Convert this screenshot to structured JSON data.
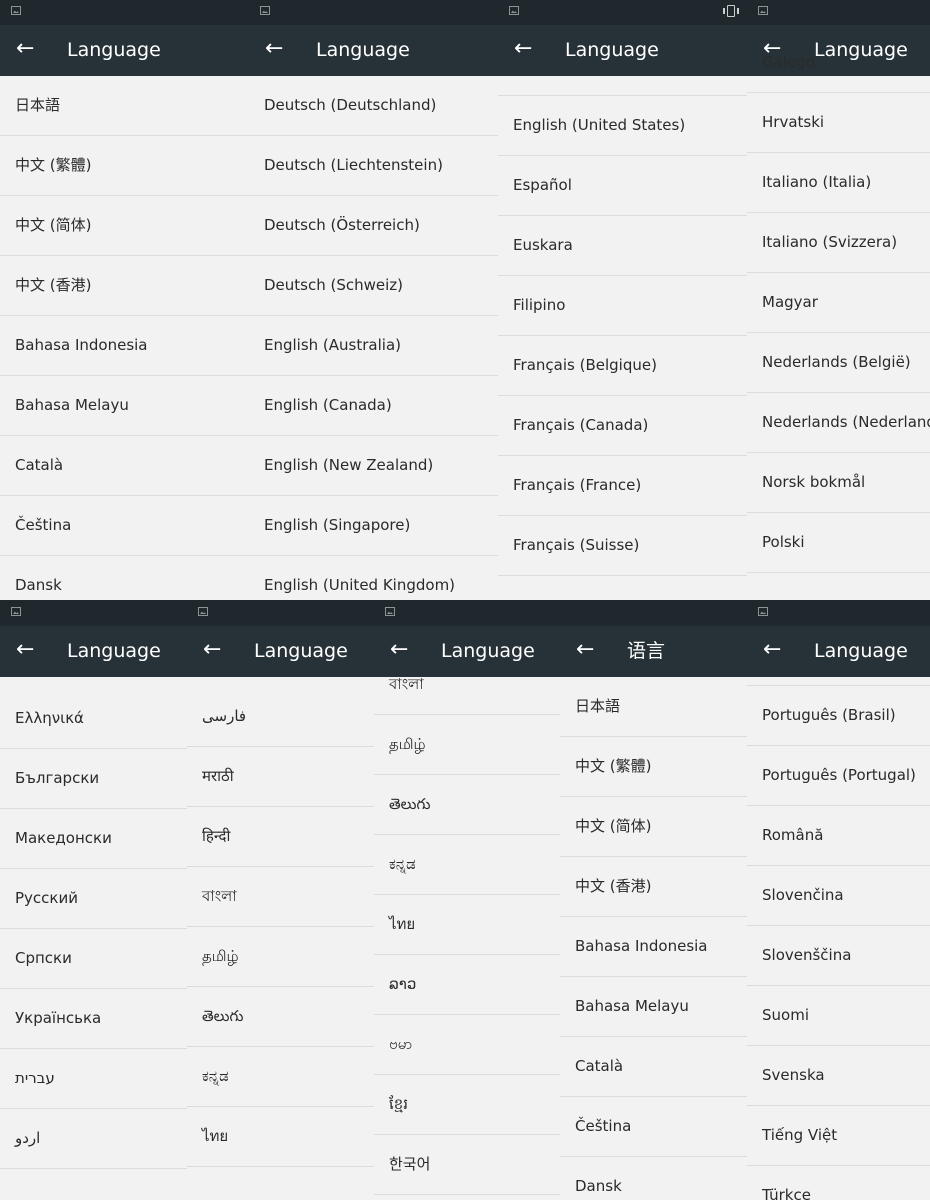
{
  "panels": [
    {
      "status_icons": [
        "image-icon"
      ],
      "title": "Language",
      "items": [
        "日本語",
        "中文 (繁體)",
        "中文 (简体)",
        "中文 (香港)",
        "Bahasa Indonesia",
        "Bahasa Melayu",
        "Català",
        "Čeština",
        "Dansk"
      ]
    },
    {
      "status_icons": [
        "image-icon"
      ],
      "title": "Language",
      "items": [
        "Deutsch (Deutschland)",
        "Deutsch (Liechtenstein)",
        "Deutsch (Österreich)",
        "Deutsch (Schweiz)",
        "English (Australia)",
        "English (Canada)",
        "English (New Zealand)",
        "English (Singapore)",
        "English (United Kingdom)"
      ]
    },
    {
      "status_icons": [
        "image-icon",
        "vibrate-icon"
      ],
      "title": "Language",
      "items": [
        "",
        "English (United States)",
        "Español",
        "Euskara",
        "Filipino",
        "Français (Belgique)",
        "Français (Canada)",
        "Français (France)",
        "Français (Suisse)"
      ]
    },
    {
      "status_icons": [
        "image-icon"
      ],
      "title": "Language",
      "items": [
        "Galego",
        "Hrvatski",
        "Italiano (Italia)",
        "Italiano (Svizzera)",
        "Magyar",
        "Nederlands (België)",
        "Nederlands (Nederland)",
        "Norsk bokmål",
        "Polski"
      ]
    },
    {
      "status_icons": [
        "image-icon"
      ],
      "title": "Language",
      "items": [
        "Ελληνικά",
        "Български",
        "Македонски",
        "Русский",
        "Српски",
        "Українська",
        "עברית",
        "اردو"
      ]
    },
    {
      "status_icons": [
        "image-icon"
      ],
      "title": "Language",
      "items": [
        "فارسی",
        "मराठी",
        "हिन्दी",
        "বাংলা",
        "தமிழ்",
        "తెలుగు",
        "ಕನ್ನಡ",
        "ไทย"
      ]
    },
    {
      "status_icons": [
        "image-icon"
      ],
      "title": "Language",
      "items": [
        "বাংলা",
        "தமிழ்",
        "తెలుగు",
        "ಕನ್ನಡ",
        "ไทย",
        "ລາວ",
        "ဗမာ",
        "ខ្មែរ",
        "한국어"
      ]
    },
    {
      "status_icons": [],
      "title": "语言",
      "items": [
        "日本語",
        "中文 (繁體)",
        "中文 (简体)",
        "中文 (香港)",
        "Bahasa Indonesia",
        "Bahasa Melayu",
        "Català",
        "Čeština",
        "Dansk"
      ]
    },
    {
      "status_icons": [
        "image-icon"
      ],
      "title": "Language",
      "items": [
        "",
        "Português (Brasil)",
        "Português (Portugal)",
        "Română",
        "Slovenčina",
        "Slovenščina",
        "Suomi",
        "Svenska",
        "Tiếng Việt",
        "Türkçe"
      ]
    }
  ],
  "back_icon": "arrow-back-icon",
  "colors": {
    "status_bar": "#1f282d",
    "app_bar": "#263238",
    "background": "#f2f2f2",
    "text": "#2a2a2a"
  }
}
